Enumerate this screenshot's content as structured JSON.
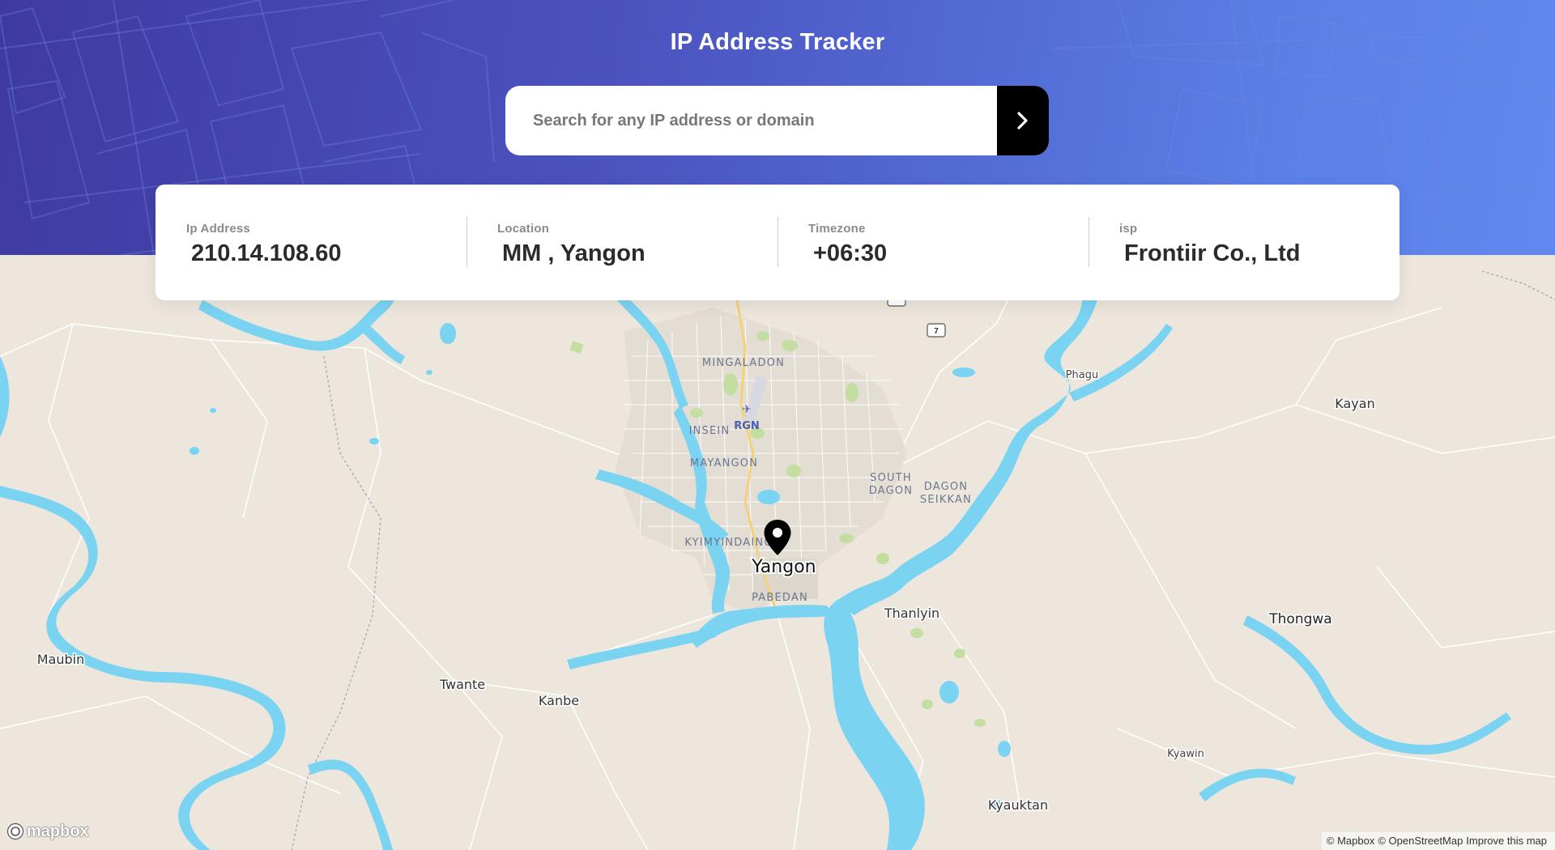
{
  "header": {
    "title": "IP Address Tracker",
    "search_placeholder": "Search for any IP address or domain",
    "search_value": ""
  },
  "info": [
    {
      "label": "Ip Address",
      "value": "210.14.108.60"
    },
    {
      "label": "Location",
      "value": "MM , Yangon"
    },
    {
      "label": "Timezone",
      "value": "+06:30"
    },
    {
      "label": "isp",
      "value": "Frontiir Co., Ltd"
    }
  ],
  "map": {
    "places": {
      "yangon": "Yangon",
      "mingaladon": "MINGALADON",
      "insein": "INSEIN",
      "rgn": "RGN",
      "mayangon": "MAYANGON",
      "south_dagon_1": "SOUTH",
      "south_dagon_2": "DAGON",
      "dagon_seikkan_1": "DAGON",
      "dagon_seikkan_2": "SEIKKAN",
      "kyimyindaing": "KYIMYINDAING",
      "pabedan": "PABEDAN",
      "thanlyin": "Thanlyin",
      "thongwa": "Thongwa",
      "maubin": "Maubin",
      "twante": "Twante",
      "kanbe": "Kanbe",
      "kyauktan": "Kyauktan",
      "kyawin": "Kyawin",
      "phagu": "Phagu",
      "kayan": "Kayan"
    },
    "road_shield": "7",
    "logo": "mapbox",
    "attribution": {
      "mapbox": "© Mapbox",
      "osm": "© OpenStreetMap",
      "improve": "Improve this map"
    }
  },
  "colors": {
    "banner_start": "#3f3aa0",
    "banner_end": "#6089f0",
    "water": "#7bd3f2",
    "land": "#ece6dd",
    "park": "#c3dea0"
  }
}
